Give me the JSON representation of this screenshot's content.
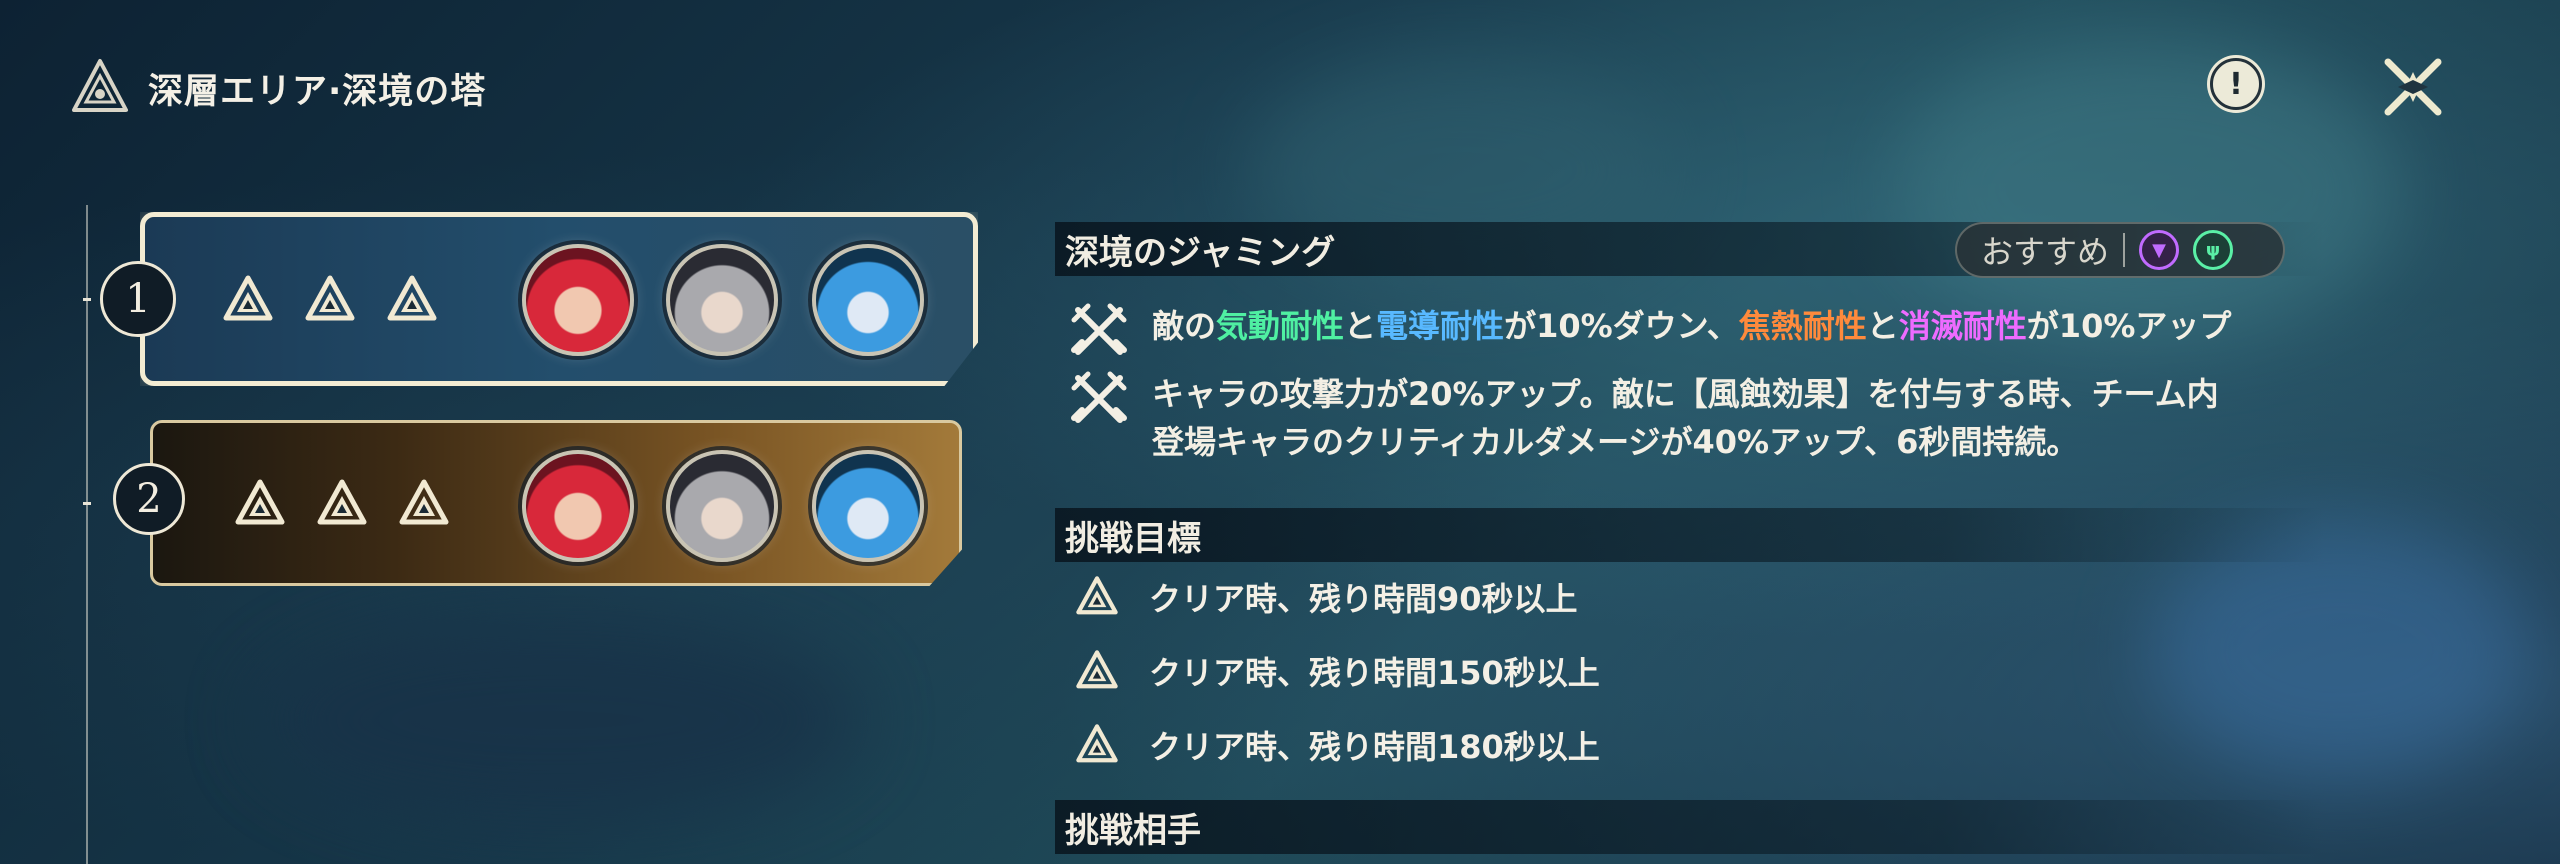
{
  "header": {
    "title": "深層エリア·深境の塔"
  },
  "buttons": {
    "info_glyph": "!"
  },
  "stages": [
    {
      "number": "1",
      "stars": 3,
      "selected": true
    },
    {
      "number": "2",
      "stars": 3,
      "selected": false
    }
  ],
  "jamming": {
    "heading": "深境のジャミング",
    "recommend_label": "おすすめ",
    "effect1": {
      "p1": "敵の",
      "k1": "気動耐性",
      "p2": "と",
      "k2": "電導耐性",
      "p3": "が10%ダウン、",
      "k3": "焦熱耐性",
      "p4": "と",
      "k4": "消滅耐性",
      "p5": "が10%アップ"
    },
    "effect2": {
      "line1": "キャラの攻撃力が20%アップ。敵に【風蝕効果】を付与する時、チーム内",
      "line2": "登場キャラのクリティカルダメージが40%アップ、6秒間持続。"
    }
  },
  "goals": {
    "heading": "挑戦目標",
    "items": [
      "クリア時、残り時間90秒以上",
      "クリア時、残り時間150秒以上",
      "クリア時、残り時間180秒以上"
    ]
  },
  "opponents": {
    "heading": "挑戦相手"
  },
  "colors": {
    "aero": "#4ff0a2",
    "electro": "#58b9ff",
    "fusion": "#ff8a3c",
    "havoc": "#ee6bff",
    "accent": "#f3ecd3"
  }
}
